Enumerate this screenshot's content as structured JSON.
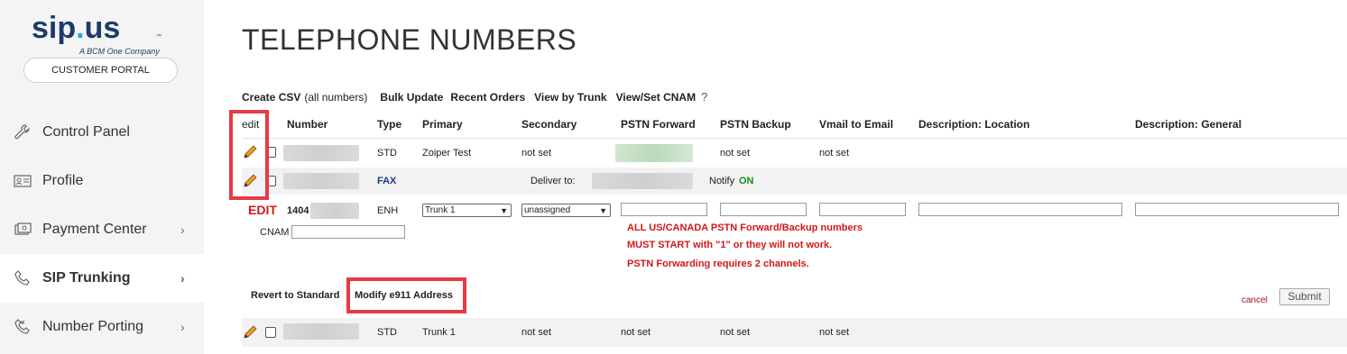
{
  "brand": {
    "logo_main": "sip",
    "logo_dot": ".",
    "logo_us": "us",
    "logo_tm": "™",
    "logo_tagline": "A BCM One Company",
    "portal_button": "CUSTOMER PORTAL"
  },
  "nav": {
    "items": [
      {
        "label": "Control Panel",
        "icon": "wrench-icon"
      },
      {
        "label": "Profile",
        "icon": "id-card-icon"
      },
      {
        "label": "Payment Center",
        "icon": "payment-icon",
        "chevron": "›"
      },
      {
        "label": "SIP Trunking",
        "icon": "phone-icon",
        "chevron": "›"
      },
      {
        "label": "Number Porting",
        "icon": "phone-transfer-icon",
        "chevron": "›"
      }
    ]
  },
  "page": {
    "title": "TELEPHONE NUMBERS"
  },
  "actions": {
    "create_csv": "Create CSV",
    "create_csv_note": "(all numbers)",
    "bulk_update": "Bulk Update",
    "recent_orders": "Recent Orders",
    "view_by_trunk": "View by Trunk",
    "view_set_cnam": "View/Set CNAM",
    "help": "?"
  },
  "table": {
    "headers": {
      "edit": "edit",
      "number": "Number",
      "type": "Type",
      "primary": "Primary",
      "secondary": "Secondary",
      "pstn_forward": "PSTN Forward",
      "pstn_backup": "PSTN Backup",
      "vmail": "Vmail to Email",
      "desc_location": "Description: Location",
      "desc_general": "Description: General"
    },
    "row1": {
      "type": "STD",
      "primary": "Zoiper Test",
      "secondary": "not set",
      "pstn_backup": "not set",
      "vmail": "not set"
    },
    "row2": {
      "type": "FAX",
      "deliver_label": "Deliver to:",
      "notify_label": "Notify",
      "notify_value": "ON"
    },
    "edit_row": {
      "edit_label": "EDIT",
      "number_prefix": "1404",
      "type": "ENH",
      "primary_selected": "Trunk 1",
      "secondary_selected": "unassigned",
      "cnam_label": "CNAM",
      "warning_lines": [
        "ALL US/CANADA PSTN Forward/Backup numbers",
        "MUST START with \"1\" or they will not work.",
        "PSTN Forwarding requires 2 channels."
      ],
      "revert": "Revert to Standard",
      "modify_e911": "Modify e911 Address",
      "cancel": "cancel",
      "submit": "Submit"
    },
    "row3": {
      "type": "STD",
      "primary": "Trunk 1",
      "secondary": "not set",
      "pstn_forward": "not set",
      "pstn_backup": "not set",
      "vmail": "not set"
    }
  },
  "colors": {
    "highlight_box": "#e53b45",
    "warning_text": "#d21818",
    "brand_navy": "#1d3a6b"
  }
}
